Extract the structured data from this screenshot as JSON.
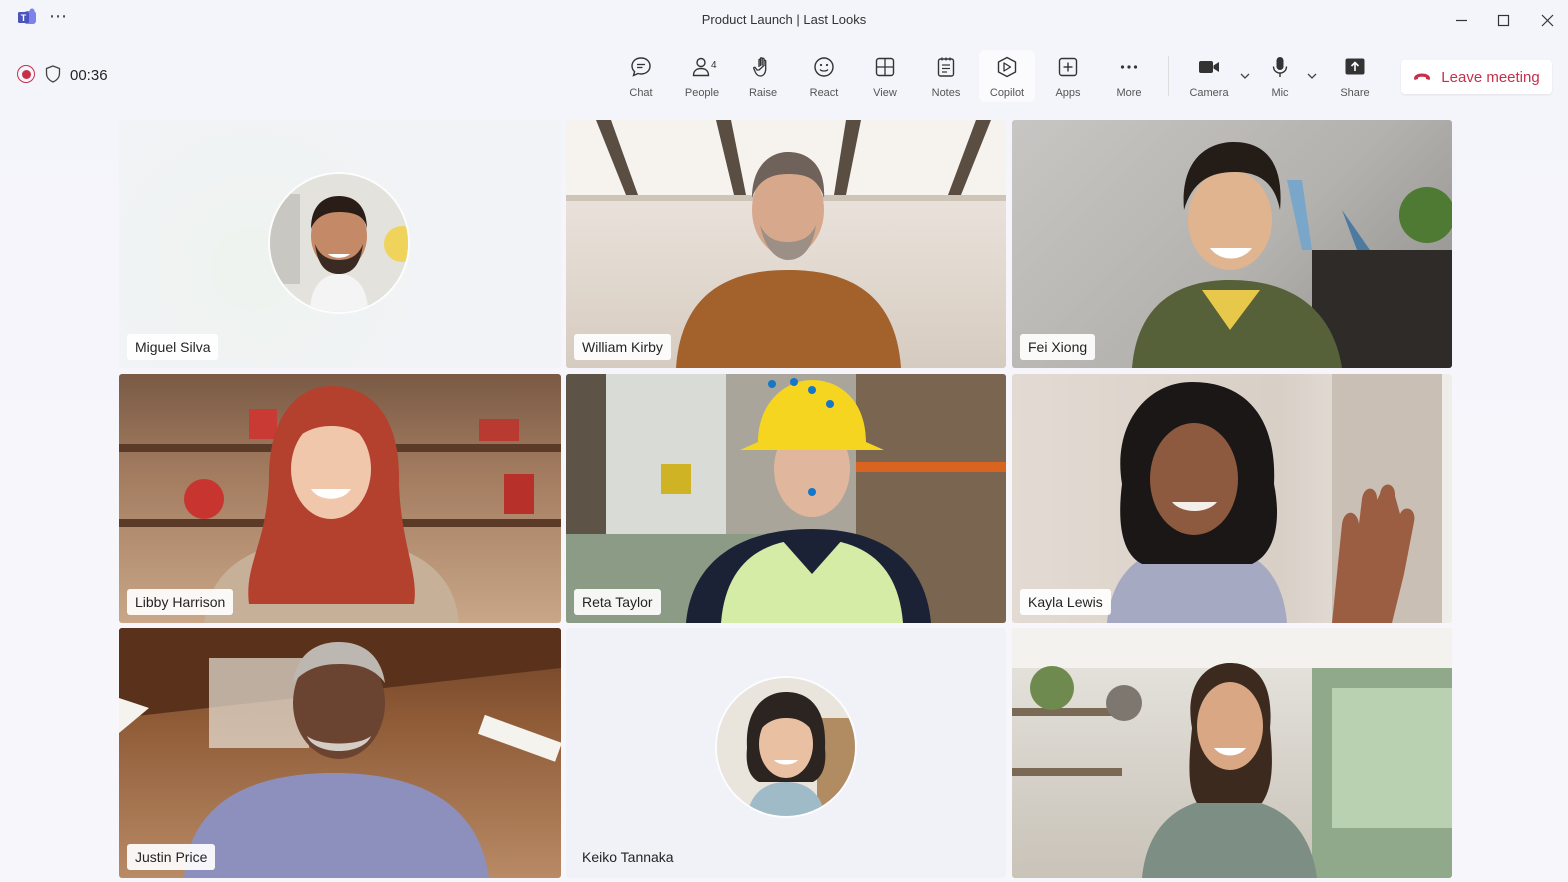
{
  "window": {
    "title": "Product Launch | Last Looks",
    "menu_dots": "⋯"
  },
  "meeting": {
    "timer": "00:36"
  },
  "toolbar": {
    "chat": "Chat",
    "people": "People",
    "people_count": "4",
    "raise": "Raise",
    "react": "React",
    "view": "View",
    "notes": "Notes",
    "copilot": "Copilot",
    "apps": "Apps",
    "more": "More",
    "camera": "Camera",
    "mic": "Mic",
    "share": "Share",
    "leave": "Leave meeting"
  },
  "participants": [
    {
      "name": "Miguel Silva",
      "video": false
    },
    {
      "name": "William Kirby",
      "video": true
    },
    {
      "name": "Fei Xiong",
      "video": true
    },
    {
      "name": "Libby Harrison",
      "video": true
    },
    {
      "name": "Reta Taylor",
      "video": true
    },
    {
      "name": "Kayla Lewis",
      "video": true
    },
    {
      "name": "Justin Price",
      "video": true
    },
    {
      "name": "Keiko Tannaka",
      "video": false
    },
    {
      "name": "",
      "video": true
    }
  ],
  "colors": {
    "accent": "#c4314b",
    "brand": "#5b5fc7"
  }
}
